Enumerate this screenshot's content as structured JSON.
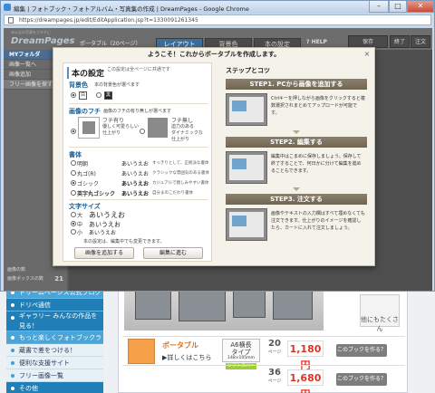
{
  "browser": {
    "title": "編集 | フォトブック・フォトアルバム・写真集の作成 | DreamPages - Google Chrome",
    "url": "https://dreampages.jp/edit/EditApplication.jsp?t=1330091261345",
    "controls": {
      "minimize": "–",
      "maximize": "□",
      "close": "✕"
    }
  },
  "app": {
    "logo_sub": "みんなの写真をカタチに",
    "logo": "DreamPages",
    "product": "ポータブル（20ページ）",
    "tabs": [
      "レイアウト",
      "背景色",
      "本の設定"
    ],
    "help": "? HELP",
    "save": "保存",
    "finish": "終了",
    "order": "注文",
    "sidebar": {
      "title": "MYフォルダ",
      "items": [
        "画像一覧へ",
        "画像追加",
        "フリー画像を探す"
      ],
      "footer_count_label": "画像の数",
      "footer_box_label": "画像ボックスの数",
      "footer_box_value": "21"
    }
  },
  "modal": {
    "title": "ようこそ！これからポータブルを作成します。",
    "close": "×",
    "settings": {
      "title": "本の設定",
      "note": "この設定は全ページに共通です",
      "bg_label": "背景色",
      "bg_desc": "本の背景色が選べます",
      "bg_white": "白",
      "bg_black": "黒",
      "frame_label": "画像のフチ",
      "frame_desc": "画像のフチの有り無しが選べます",
      "frame_on_title": "フチ有り",
      "frame_on_desc1": "優しく可愛らしい",
      "frame_on_desc2": "仕上がり",
      "frame_off_title": "フチ無し",
      "frame_off_desc1": "迫力のある",
      "frame_off_desc2": "ダイナミックな",
      "frame_off_desc3": "仕上がり",
      "font_label": "書体",
      "fonts": [
        {
          "name": "明朝",
          "sample": "あいうえお",
          "desc": "すっきりとして、正統派な書体"
        },
        {
          "name": "丸ゴ(R)",
          "sample": "あいうえお",
          "desc": "クラシックな雰囲気のある書体"
        },
        {
          "name": "ゴシック",
          "sample": "あいうえお",
          "desc": "カジュアルで親しみやすい書体"
        },
        {
          "name": "英字丸ゴシック",
          "sample": "あいうえお",
          "desc": "自分まのこだわり書体"
        }
      ],
      "size_label": "文字サイズ",
      "sizes": [
        {
          "name": "大",
          "sample": "あいうえお"
        },
        {
          "name": "中",
          "sample": "あいうえお"
        },
        {
          "name": "小",
          "sample": "あいうえお"
        }
      ],
      "footnote": "本の設定は、編集中でも変更できます。",
      "add_images_button": "画像を追加する",
      "proceed_button": "編集に進む"
    },
    "steps": {
      "title": "ステップとコツ",
      "step1_head": "STEP1. PCから画像を追加する",
      "step1_text": "Ctrlキーを押しながら画像をクリックすると複数選択されまとめてアップロードが可能です。",
      "step2_head": "STEP2. 編集する",
      "step2_text": "編集中はこまめに保存しましょう。保存して終了することで、何日かに分けて編集を進めることもできます。",
      "step3_head": "STEP3. 注文する",
      "step3_text": "画像やテキストの入力欄はすべて埋めなくても注文できます。仕上がりのイメージを確認したら、カートに入れて注文しましょう。"
    }
  },
  "site": {
    "sidebar": [
      {
        "label": "ドリームページス公式ブログ",
        "type": "hd"
      },
      {
        "label": "ドリペ通信",
        "type": "normal"
      },
      {
        "label": "ギャラリー みんなの作品を見る！",
        "type": "big"
      },
      {
        "label": "もっと楽しくフォトブックライフ",
        "type": "hd"
      },
      {
        "label": "蔵書で差をつける！",
        "type": "sub"
      },
      {
        "label": "便利な支援サイト",
        "type": "sub"
      },
      {
        "label": "フリー画像一覧",
        "type": "sub"
      },
      {
        "label": "その他",
        "type": "normal"
      }
    ],
    "recommend": "他にもたくさん",
    "products": [
      {
        "name": "ポータブル",
        "link": "詳しくはこちら",
        "badge_title": "A6横長",
        "badge_sub": "タイプ",
        "size": "148×105mm",
        "cover": "ソフトカバー",
        "pages": "20",
        "pages_unit": "ページ",
        "price": "1,180円",
        "order": "このブックを作る？"
      },
      {
        "name": "",
        "link": "",
        "badge_title": "",
        "badge_sub": "",
        "size": "",
        "cover": "",
        "pages": "36",
        "pages_unit": "ページ",
        "price": "1,680円",
        "order": "このブックを作る？"
      }
    ]
  }
}
